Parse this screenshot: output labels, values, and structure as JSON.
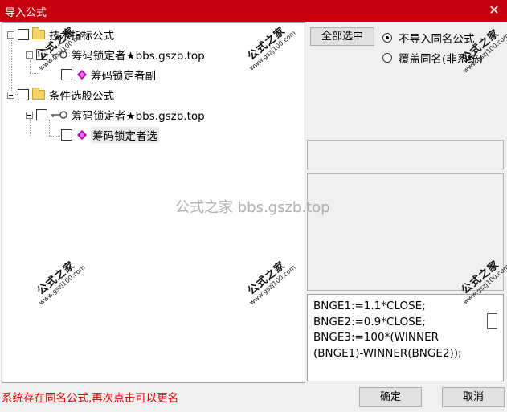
{
  "window": {
    "title": "导入公式",
    "close_glyph": "✕"
  },
  "tree": {
    "nodes": [
      {
        "label": "技术指标公式",
        "icon": "folder-icon"
      },
      {
        "label": "筹码锁定者★bbs.gszb.top",
        "icon": "key-icon"
      },
      {
        "label": "筹码锁定者副",
        "icon": "formula-gem-icon"
      },
      {
        "label": "条件选股公式",
        "icon": "folder-icon"
      },
      {
        "label": "筹码锁定者★bbs.gszb.top",
        "icon": "key-icon"
      },
      {
        "label": "筹码锁定者选",
        "icon": "formula-gem-icon",
        "selected": true
      }
    ]
  },
  "controls": {
    "select_all": "全部选中",
    "options": [
      {
        "label": "不导入同名公式",
        "checked": true
      },
      {
        "label": "覆盖同名(非系统)",
        "checked": false
      }
    ]
  },
  "formula_lines": [
    "BNGE1:=1.1*CLOSE;",
    "BNGE2:=0.9*CLOSE;",
    "BNGE3:=100*(WINNER",
    "(BNGE1)-WINNER(BNGE2));"
  ],
  "watermark": {
    "center_text": "公式之家 bbs.gszb.top",
    "stamp_title": "公式之家",
    "stamp_url": "www.gszj100.com"
  },
  "status_text": "系统存在同名公式,再次点击可以更名",
  "buttons": {
    "ok": "确定",
    "cancel": "取消"
  },
  "colors": {
    "titlebar": "#c5000e",
    "status": "#e00000",
    "gem": "#b000b0"
  }
}
